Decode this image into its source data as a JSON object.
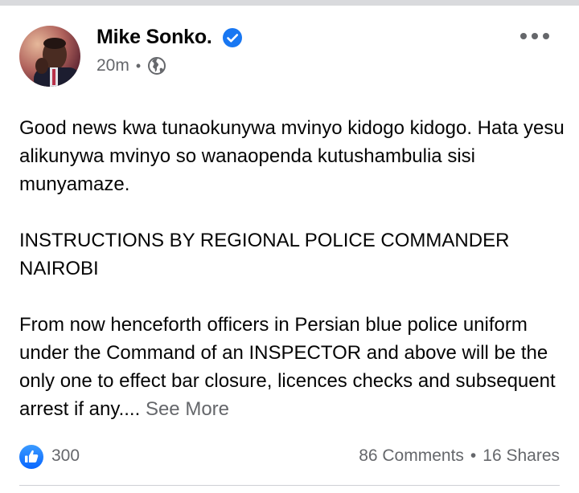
{
  "post": {
    "author": "Mike Sonko.",
    "time": "20m",
    "meta_separator": "•",
    "paragraphs": [
      "Good news kwa tunaokunywa mvinyo kidogo kidogo. Hata yesu alikunywa mvinyo so wanaopenda kutushambulia sisi munyamaze.",
      "INSTRUCTIONS BY REGIONAL POLICE COMMANDER NAIROBI"
    ],
    "last_paragraph": "From now henceforth officers in Persian blue police uniform under the Command of an INSPECTOR and above will be the only one to effect bar closure, licences checks and subsequent arrest if any....",
    "see_more": "See More"
  },
  "footer": {
    "reactions": "300",
    "comments": "86 Comments",
    "separator": "•",
    "shares": "16 Shares"
  },
  "icons": {
    "verified": "verified-badge-icon",
    "audience": "globe-icon",
    "menu": "more-options-icon",
    "reaction": "like-icon"
  },
  "colors": {
    "facebook_blue": "#1877f2",
    "secondary_text": "#65676b"
  }
}
